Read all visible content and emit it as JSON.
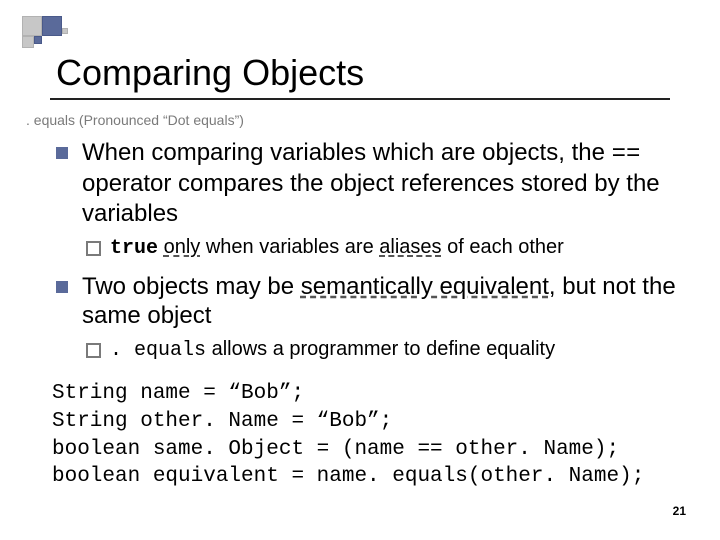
{
  "title": "Comparing Objects",
  "subtitle": ". equals (Pronounced “Dot equals”)",
  "bullets": {
    "b1": {
      "pre": "When comparing variables which are objects, the ",
      "op": "==",
      "post": " operator compares the object references stored by the variables",
      "sub": {
        "kw": "true",
        "mid1": " ",
        "only": "only",
        "mid2": " when variables are ",
        "aliases": "aliases",
        "tail": " of each other"
      }
    },
    "b2": {
      "pre": "Two objects may be ",
      "sem": "semantically equivalent",
      "post": ", but not the same object",
      "sub": {
        "eq": ". equals",
        "tail": " allows a programmer to define equality"
      }
    }
  },
  "code": "String name = “Bob”;\nString other. Name = “Bob”;\nboolean same. Object = (name == other. Name);\nboolean equivalent = name. equals(other. Name);",
  "pageNumber": "21"
}
